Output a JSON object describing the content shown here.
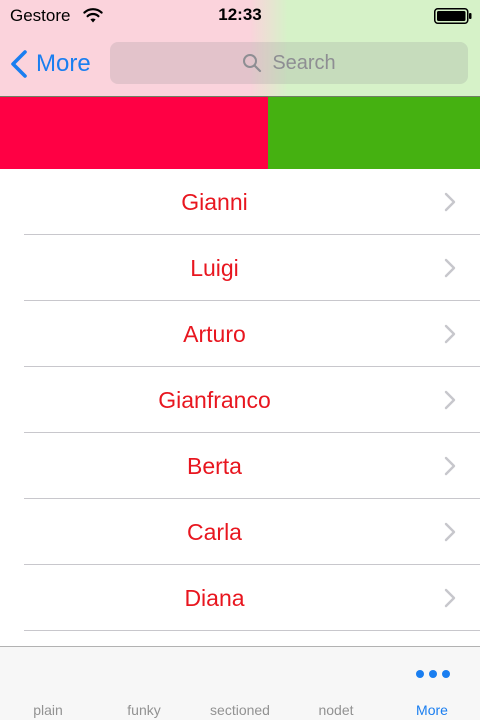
{
  "status_bar": {
    "carrier": "Gestore",
    "time": "12:33",
    "wifi_icon": "wifi-icon",
    "battery_icon": "battery-full-icon"
  },
  "nav_bar": {
    "back_label": "More",
    "search_placeholder": "Search"
  },
  "color_band": {
    "left_color": "#ff0044",
    "right_color": "#45b111"
  },
  "list": {
    "items": [
      {
        "label": "Gianni"
      },
      {
        "label": "Luigi"
      },
      {
        "label": "Arturo"
      },
      {
        "label": "Gianfranco"
      },
      {
        "label": "Berta"
      },
      {
        "label": "Carla"
      },
      {
        "label": "Diana"
      }
    ],
    "text_color": "#e8161f"
  },
  "tab_bar": {
    "tabs": [
      {
        "label": "plain"
      },
      {
        "label": "funky"
      },
      {
        "label": "sectioned"
      },
      {
        "label": "nodet"
      },
      {
        "label": "More",
        "icon": "more-dots-icon",
        "selected": true
      }
    ],
    "accent": "#1a7ef0"
  }
}
